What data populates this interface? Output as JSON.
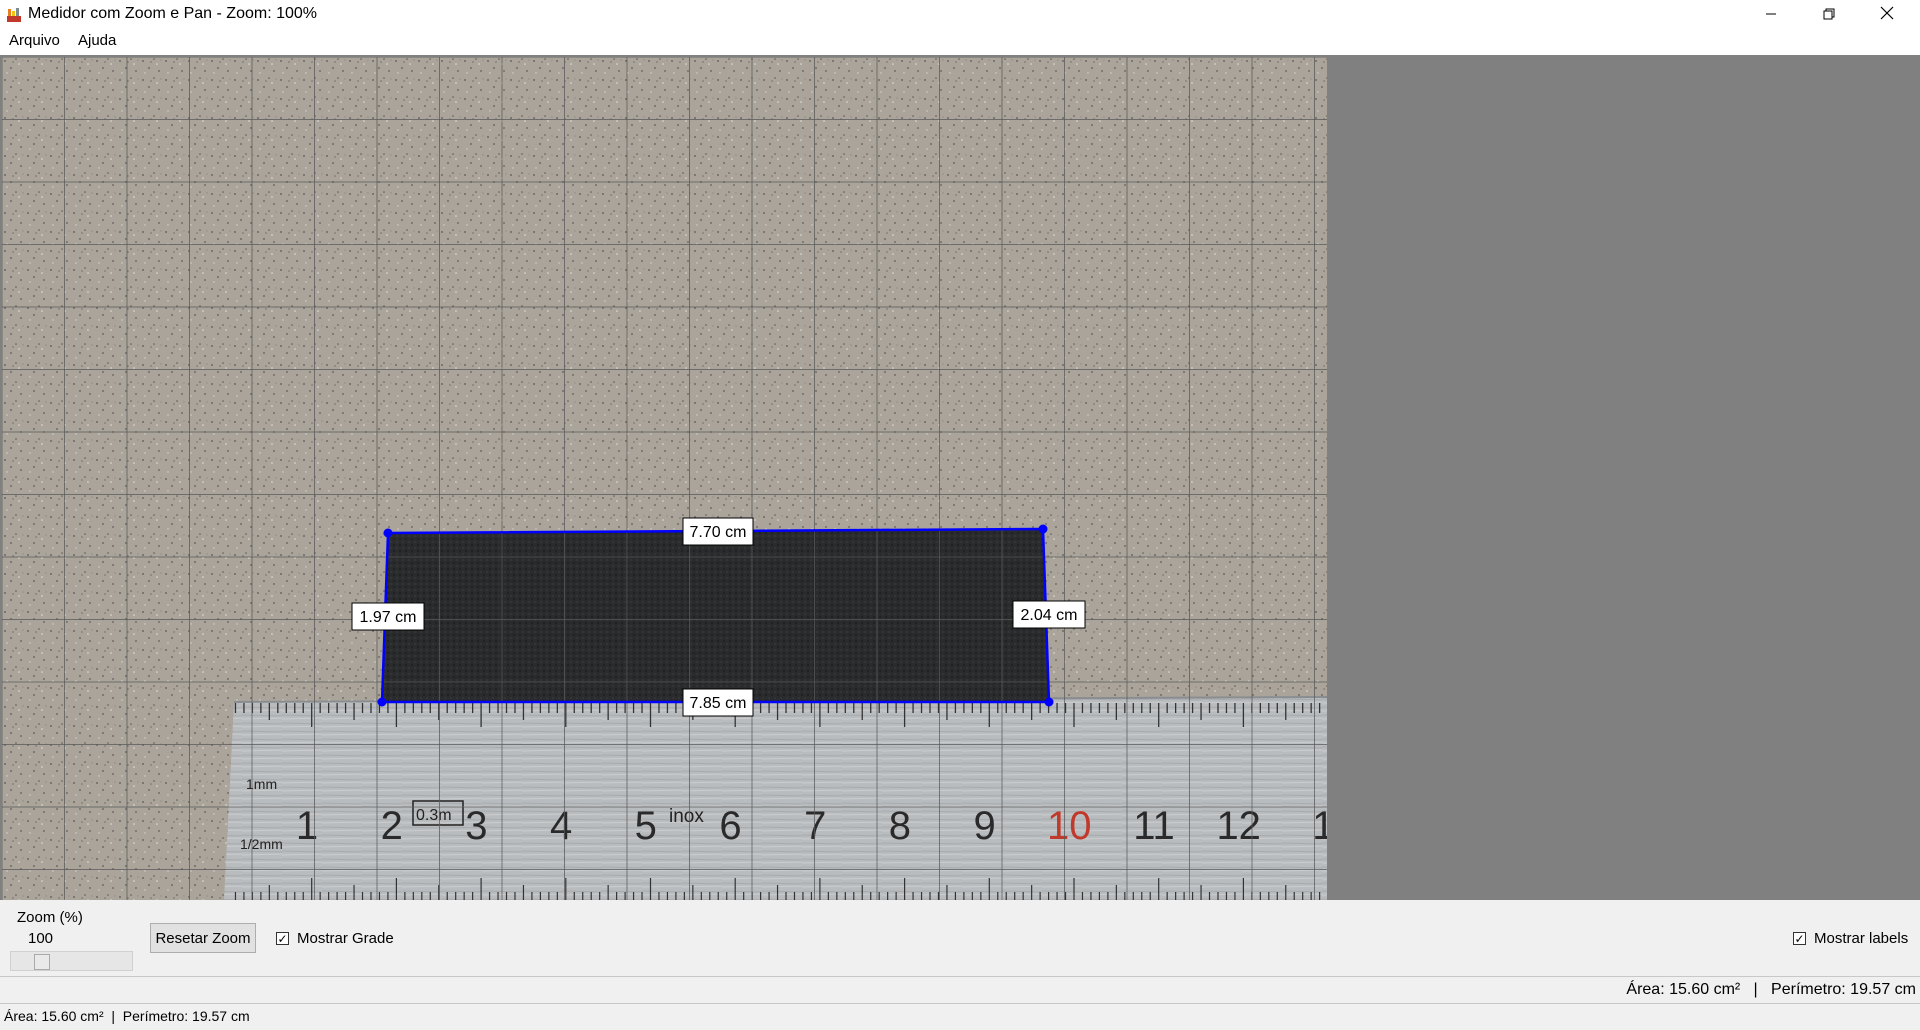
{
  "window": {
    "title": "Medidor com Zoom e Pan - Zoom: 100%",
    "minimize_icon": "minimize-icon",
    "maximize_icon": "restore-icon",
    "close_icon": "close-icon"
  },
  "menu": {
    "items": [
      {
        "label": "Arquivo"
      },
      {
        "label": "Ajuda"
      }
    ]
  },
  "canvas": {
    "grid_visible": true,
    "labels_visible": true,
    "polygon_color": "#0000ff",
    "measurements": {
      "top": "7.70 cm",
      "bottom": "7.85 cm",
      "left": "1.97 cm",
      "right": "2.04 cm"
    },
    "ruler": {
      "scale_text_mm": "1mm",
      "scale_text_half_mm": "1/2mm",
      "badge": "0.3m",
      "brand": "inox",
      "numbers": [
        "1",
        "2",
        "3",
        "4",
        "5",
        "6",
        "7",
        "8",
        "9",
        "10",
        "11",
        "12",
        "1"
      ]
    }
  },
  "controls": {
    "zoom_label": "Zoom (%)",
    "zoom_value": "100",
    "zoom_level": 100,
    "reset_zoom_label": "Resetar Zoom",
    "show_grid_label": "Mostrar Grade",
    "show_grid_checked": true,
    "show_labels_label": "Mostrar labels",
    "show_labels_checked": true
  },
  "status": {
    "right_text": "Área: 15.60 cm²   |   Perímetro: 19.57 cm",
    "bottom_text": "Área: 15.60 cm²  |  Perímetro: 19.57 cm"
  }
}
